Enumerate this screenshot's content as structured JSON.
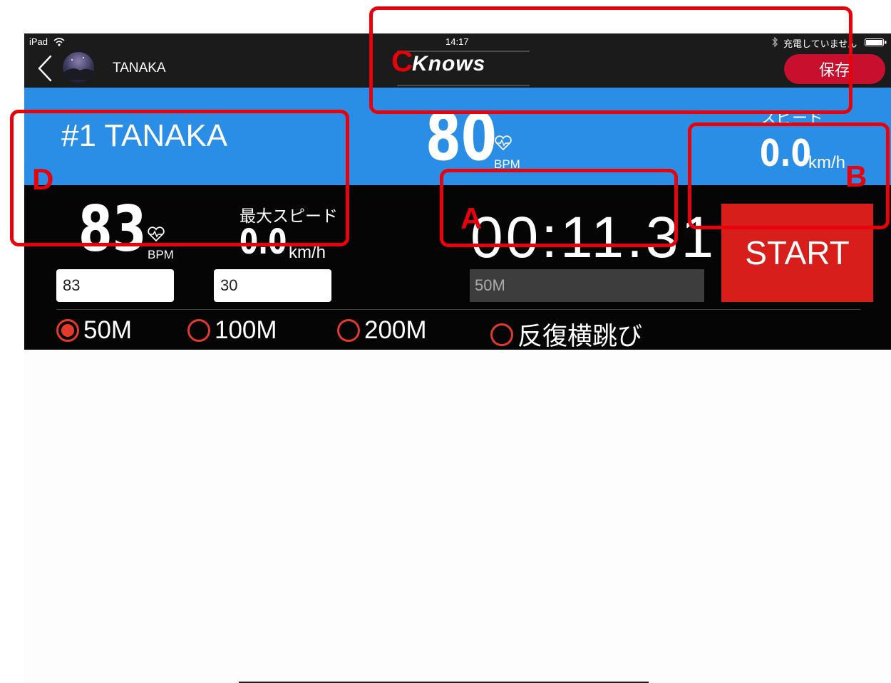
{
  "status_bar": {
    "device": "iPad",
    "time": "14:17",
    "charging": "充電していません"
  },
  "nav": {
    "title": "TANAKA",
    "logo": "Knows",
    "save_label": "保存"
  },
  "player": {
    "label": "#1 TANAKA",
    "heart_rate": "80",
    "heart_unit": "BPM",
    "speed_label": "スピード",
    "speed": "0.0",
    "speed_unit": "km/h"
  },
  "panel": {
    "max_hr": "83",
    "max_hr_unit": "BPM",
    "max_speed_label": "最大スピード",
    "max_speed": "0.0",
    "max_speed_unit": "km/h",
    "input_hr": "83",
    "input_speed": "30",
    "timer": "00:11.31",
    "event": "50M",
    "start_label": "START"
  },
  "events": [
    {
      "label": "50M",
      "selected": true
    },
    {
      "label": "100M",
      "selected": false
    },
    {
      "label": "200M",
      "selected": false
    },
    {
      "label": "反復横跳び",
      "selected": false
    }
  ],
  "annotations": [
    "A",
    "B",
    "C",
    "D"
  ],
  "colors": {
    "annotation": "#e8000a",
    "accent_blue": "#2a8ee6",
    "start_red": "#d81e1a",
    "save_red": "#c8102e"
  }
}
